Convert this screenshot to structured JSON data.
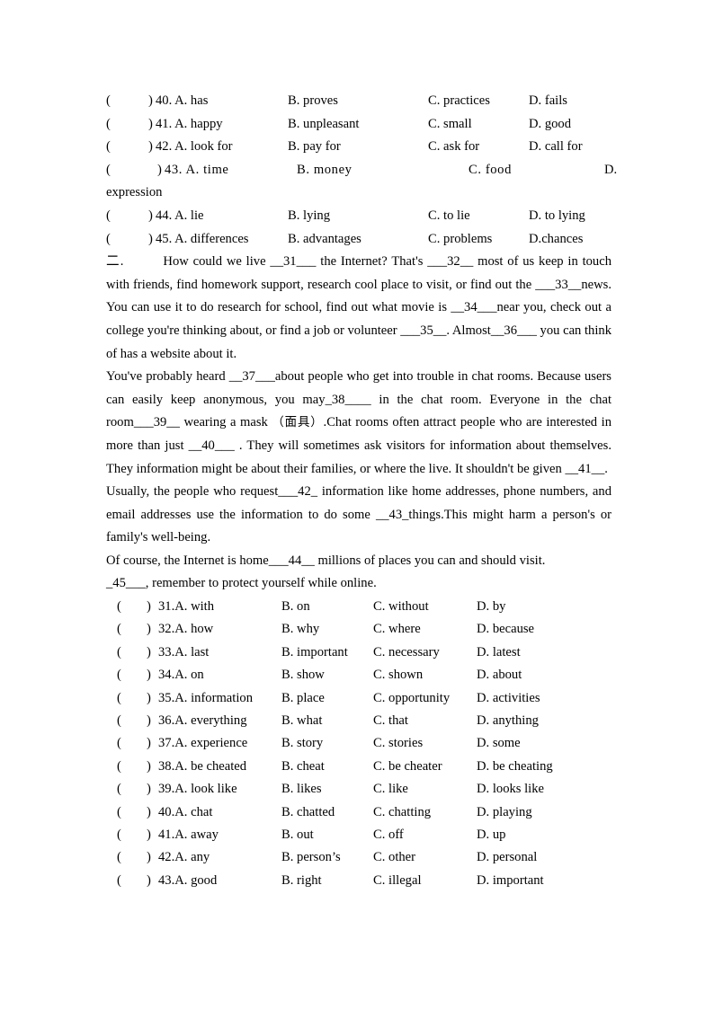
{
  "document": {
    "background_color": "#ffffff",
    "text_color": "#000000"
  },
  "upper_options": {
    "paren_open": "(",
    "paren_close": ")",
    "rows": [
      {
        "number": "40.",
        "a": "A. has",
        "b": "B. proves",
        "c": "C. practices",
        "d": "D. fails"
      },
      {
        "number": "41.",
        "a": "A. happy",
        "b": "B. unpleasant",
        "c": "C. small",
        "d": "D. good"
      },
      {
        "number": "42.",
        "a": "A. look for",
        "b": "B. pay for",
        "c": "C. ask for",
        "d": "D. call for"
      },
      {
        "number": "43.",
        "a": "A.  time",
        "b": "B.  money",
        "c": "C.  food",
        "d": "D."
      },
      {
        "number": "44.",
        "a": "A. lie",
        "b": "B. lying",
        "c": "C. to lie",
        "d": "D. to lying"
      },
      {
        "number": "45.",
        "a": "A. differences",
        "b": "B. advantages",
        "c": "C. problems",
        "d": "D.chances"
      }
    ],
    "overflow_word": "expression"
  },
  "passage": {
    "section_label": "二.",
    "paragraph_1_part_1": "How could we live ",
    "blank_31": "__31___",
    "paragraph_1_part_2": " the Internet? That's ",
    "blank_32": "___32__",
    "paragraph_1_part_3": " most of us keep in touch with friends, find homework support, research cool place to visit, or find out the ",
    "blank_33": "___33__",
    "paragraph_1_part_4": "news. You can use it to do research for school, find out what movie is ",
    "blank_34": "__34___",
    "paragraph_1_part_5": "near you, check out a college you're thinking about, or find a job or volunteer ",
    "blank_35": "___35__",
    "paragraph_1_part_6": ". Almost",
    "blank_36": "__36___",
    "paragraph_1_part_7": " you can think of has a website about it.",
    "paragraph_2_part_1": "You've probably heard ",
    "blank_37": "__37___",
    "paragraph_2_part_2": "about people who get into trouble in chat rooms. Because users can easily keep anonymous, you may",
    "blank_38": "_38____",
    "paragraph_2_part_3": " in the chat room. Everyone in the chat room",
    "blank_39": "___39__",
    "paragraph_2_part_4": " wearing a mask ",
    "mask_cn": "（面具）",
    "paragraph_2_part_5": ".Chat rooms often attract people who are interested in more than just ",
    "blank_40": "__40___",
    "paragraph_2_part_6": " . They will sometimes ask visitors for information about themselves. They information might be about their families, or where the live. It shouldn't be given ",
    "blank_41": "__41__",
    "paragraph_2_part_7": ".",
    "paragraph_3_part_1": "Usually, the people who request",
    "blank_42": "___42_",
    "paragraph_3_part_2": " information like home addresses, phone numbers, and email addresses use the information to do some ",
    "blank_43": "__43_",
    "paragraph_3_part_3": "things.This might harm a person's or family's well-being.",
    "paragraph_4_part_1": "Of course, the Internet is home",
    "blank_44": "___44__",
    "paragraph_4_part_2": " millions of places you can and should visit.",
    "paragraph_5_part_1": "_45___",
    "paragraph_5_part_2": ", remember to protect yourself while online."
  },
  "lower_options": {
    "paren_open": "(",
    "paren_close": ")",
    "rows": [
      {
        "number": "31.",
        "a": "A. with",
        "b": "B. on",
        "c": "C. without",
        "d": "D. by"
      },
      {
        "number": "32.",
        "a": "A. how",
        "b": "B. why",
        "c": "C. where",
        "d": "D. because"
      },
      {
        "number": "33.",
        "a": "A. last",
        "b": "B. important",
        "c": "C. necessary",
        "d": "D. latest"
      },
      {
        "number": "34.",
        "a": "A. on",
        "b": "B. show",
        "c": "C. shown",
        "d": "D. about"
      },
      {
        "number": "35.",
        "a": "A. information",
        "b": "B. place",
        "c": "C. opportunity",
        "d": "D. activities"
      },
      {
        "number": "36.",
        "a": "A. everything",
        "b": "B. what",
        "c": "C. that",
        "d": "D. anything"
      },
      {
        "number": "37.",
        "a": "A. experience",
        "b": "B. story",
        "c": "C. stories",
        "d": "D. some"
      },
      {
        "number": "38.",
        "a": "A. be cheated",
        "b": "B. cheat",
        "c": "C. be cheater",
        "d": "D. be cheating"
      },
      {
        "number": "39.",
        "a": "A. look like",
        "b": "B. likes",
        "c": "C. like",
        "d": "D. looks like"
      },
      {
        "number": "40.",
        "a": "A. chat",
        "b": "B. chatted",
        "c": "C. chatting",
        "d": "D. playing"
      },
      {
        "number": "41.",
        "a": "A. away",
        "b": "B. out",
        "c": "C. off",
        "d": "D. up"
      },
      {
        "number": "42.",
        "a": "A. any",
        "b": "B. person’s",
        "c": "C. other",
        "d": "D. personal"
      },
      {
        "number": "43.",
        "a": "A. good",
        "b": "B. right",
        "c": "C. illegal",
        "d": "D. important"
      }
    ]
  }
}
